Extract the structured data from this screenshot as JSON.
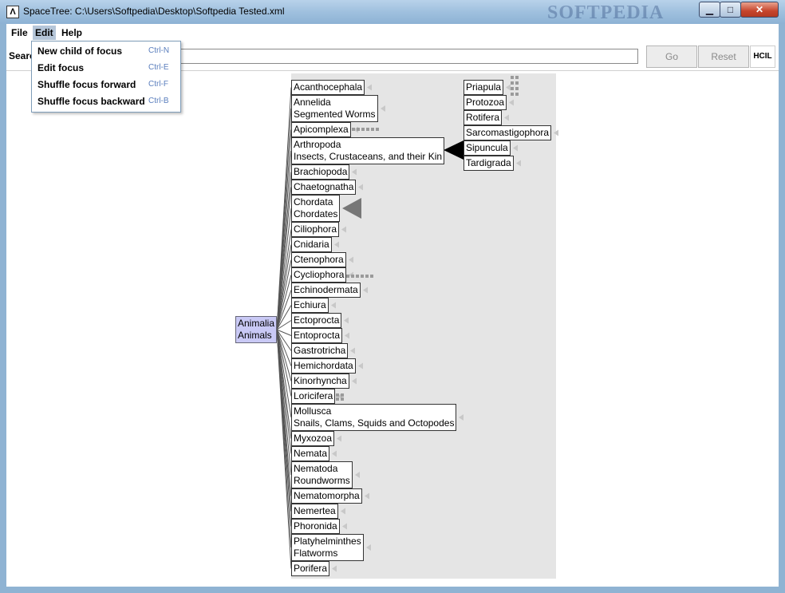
{
  "window": {
    "title": "SpaceTree: C:\\Users\\Softpedia\\Desktop\\Softpedia Tested.xml",
    "watermark": "SOFTPEDIA",
    "controls": {
      "minimize": "▁",
      "maximize": "□",
      "close": "✕"
    }
  },
  "menu": {
    "file": "File",
    "edit": "Edit",
    "help": "Help"
  },
  "edit_menu": [
    {
      "label": "New child of focus",
      "shortcut": "Ctrl-N"
    },
    {
      "label": "Edit focus",
      "shortcut": "Ctrl-E"
    },
    {
      "label": "Shuffle focus forward",
      "shortcut": "Ctrl-F"
    },
    {
      "label": "Shuffle focus backward",
      "shortcut": "Ctrl-B"
    }
  ],
  "search": {
    "label": "Search",
    "value": "",
    "go": "Go",
    "reset": "Reset",
    "logo": "HCIL"
  },
  "tree": {
    "root": [
      "Animalia",
      "Animals"
    ],
    "children": [
      [
        "Acanthocephala"
      ],
      [
        "Annelida",
        "Segmented Worms"
      ],
      [
        "Apicomplexa"
      ],
      [
        "Arthropoda",
        "Insects, Crustaceans, and their Kin"
      ],
      [
        "Brachiopoda"
      ],
      [
        "Chaetognatha"
      ],
      [
        "Chordata",
        "Chordates"
      ],
      [
        "Ciliophora"
      ],
      [
        "Cnidaria"
      ],
      [
        "Ctenophora"
      ],
      [
        "Cycliophora"
      ],
      [
        "Echinodermata"
      ],
      [
        "Echiura"
      ],
      [
        "Ectoprocta"
      ],
      [
        "Entoprocta"
      ],
      [
        "Gastrotricha"
      ],
      [
        "Hemichordata"
      ],
      [
        "Kinorhyncha"
      ],
      [
        "Loricifera"
      ],
      [
        "Mollusca",
        "Snails, Clams, Squids and Octopodes"
      ],
      [
        "Myxozoa"
      ],
      [
        "Nemata"
      ],
      [
        "Nematoda",
        "Roundworms"
      ],
      [
        "Nematomorpha"
      ],
      [
        "Nemertea"
      ],
      [
        "Phoronida"
      ],
      [
        "Platyhelminthes",
        "Flatworms"
      ],
      [
        "Porifera"
      ]
    ],
    "right_column": [
      [
        "Priapula"
      ],
      [
        "Protozoa"
      ],
      [
        "Rotifera"
      ],
      [
        "Sarcomastigophora"
      ],
      [
        "Sipuncula"
      ],
      [
        "Tardigrada"
      ]
    ]
  },
  "colors": {
    "root_fill": "#c9c9f5",
    "canvas_bg": "#e5e5e5",
    "link": "#555555"
  }
}
